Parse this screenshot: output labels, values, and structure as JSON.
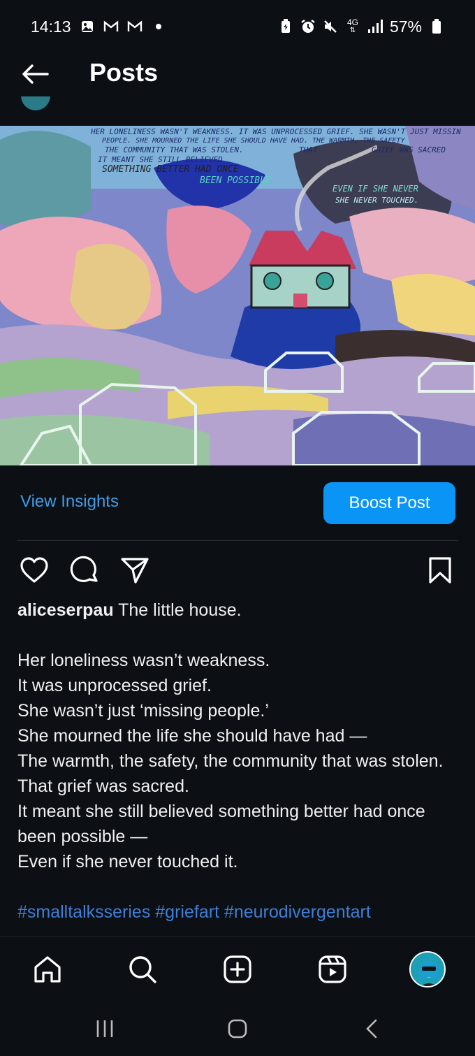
{
  "status_bar": {
    "time": "14:13",
    "network": "4G",
    "battery": "57%",
    "icons": [
      "image-notification-icon",
      "gmail-icon",
      "gmail-icon",
      "dot-icon",
      "battery-saver-icon",
      "alarm-icon",
      "mute-icon",
      "network-icon",
      "signal-icon",
      "battery-icon"
    ]
  },
  "header": {
    "title": "Posts",
    "back_icon": "arrow-left-icon"
  },
  "post": {
    "image_text_lines": [
      "HER LONELINESS WASN'T WEAKNESS. IT WAS UNPROCESSED GRIEF. SHE WASN'T JUST MISSIN",
      "PEOPLE. SHE MOURNED THE LIFE SHE SHOULD HAVE HAD. THE WARMTH, THE SAFETY",
      "THE COMMUNITY THAT WAS STOLEN.",
      "THAT",
      "GRIEF WAS SACRED",
      "IT MEANT SHE STILL BELIEVED",
      "SOMETHING BETTER HAD ONCE",
      "BEEN POSSIBLE",
      "EVEN IF SHE NEVER",
      "SHE NEVER TOUCHED."
    ],
    "view_insights": "View Insights",
    "boost_post": "Boost Post",
    "actions": [
      "heart-icon",
      "comment-icon",
      "share-icon",
      "bookmark-icon"
    ],
    "caption": {
      "username": "aliceserpau",
      "title": " The little house.",
      "lines": [
        "Her loneliness wasn’t weakness.",
        "It was unprocessed grief.",
        "She wasn’t just ‘missing people.’",
        "She mourned the life she should have had —",
        "The warmth, the safety, the community that was stolen.",
        "That grief was sacred.",
        "It meant she still believed something better had once been possible —",
        "Even if she never touched it."
      ],
      "hashtags": "#smalltalksseries #griefart #neurodivergentart"
    }
  },
  "bottom_nav": [
    "home-icon",
    "search-icon",
    "create-icon",
    "reels-icon",
    "profile-avatar"
  ],
  "system_nav": [
    "recents-icon",
    "home-button-icon",
    "back-icon"
  ],
  "colors": {
    "background": "#0c0f14",
    "link": "#3f9ee8",
    "button": "#0a95f6",
    "hashtag": "#3f7fd6"
  }
}
